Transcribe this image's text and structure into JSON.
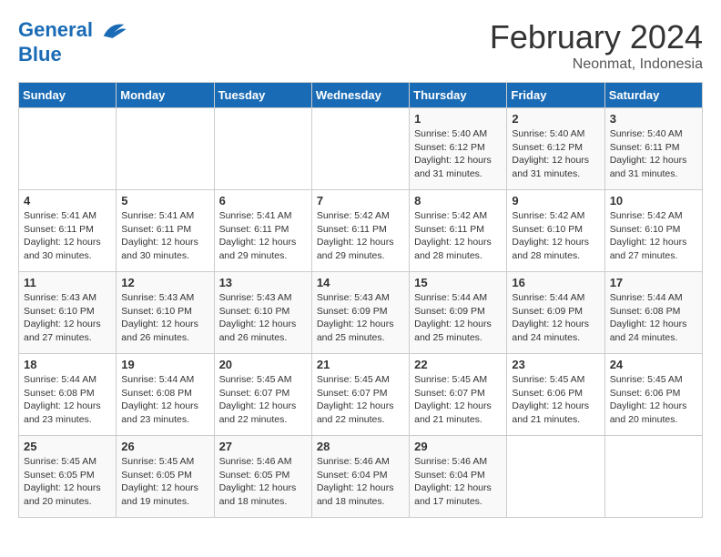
{
  "header": {
    "logo_line1": "General",
    "logo_line2": "Blue",
    "month_title": "February 2024",
    "subtitle": "Neonmat, Indonesia"
  },
  "days_of_week": [
    "Sunday",
    "Monday",
    "Tuesday",
    "Wednesday",
    "Thursday",
    "Friday",
    "Saturday"
  ],
  "weeks": [
    [
      {
        "day": "",
        "info": ""
      },
      {
        "day": "",
        "info": ""
      },
      {
        "day": "",
        "info": ""
      },
      {
        "day": "",
        "info": ""
      },
      {
        "day": "1",
        "info": "Sunrise: 5:40 AM\nSunset: 6:12 PM\nDaylight: 12 hours\nand 31 minutes."
      },
      {
        "day": "2",
        "info": "Sunrise: 5:40 AM\nSunset: 6:12 PM\nDaylight: 12 hours\nand 31 minutes."
      },
      {
        "day": "3",
        "info": "Sunrise: 5:40 AM\nSunset: 6:11 PM\nDaylight: 12 hours\nand 31 minutes."
      }
    ],
    [
      {
        "day": "4",
        "info": "Sunrise: 5:41 AM\nSunset: 6:11 PM\nDaylight: 12 hours\nand 30 minutes."
      },
      {
        "day": "5",
        "info": "Sunrise: 5:41 AM\nSunset: 6:11 PM\nDaylight: 12 hours\nand 30 minutes."
      },
      {
        "day": "6",
        "info": "Sunrise: 5:41 AM\nSunset: 6:11 PM\nDaylight: 12 hours\nand 29 minutes."
      },
      {
        "day": "7",
        "info": "Sunrise: 5:42 AM\nSunset: 6:11 PM\nDaylight: 12 hours\nand 29 minutes."
      },
      {
        "day": "8",
        "info": "Sunrise: 5:42 AM\nSunset: 6:11 PM\nDaylight: 12 hours\nand 28 minutes."
      },
      {
        "day": "9",
        "info": "Sunrise: 5:42 AM\nSunset: 6:10 PM\nDaylight: 12 hours\nand 28 minutes."
      },
      {
        "day": "10",
        "info": "Sunrise: 5:42 AM\nSunset: 6:10 PM\nDaylight: 12 hours\nand 27 minutes."
      }
    ],
    [
      {
        "day": "11",
        "info": "Sunrise: 5:43 AM\nSunset: 6:10 PM\nDaylight: 12 hours\nand 27 minutes."
      },
      {
        "day": "12",
        "info": "Sunrise: 5:43 AM\nSunset: 6:10 PM\nDaylight: 12 hours\nand 26 minutes."
      },
      {
        "day": "13",
        "info": "Sunrise: 5:43 AM\nSunset: 6:10 PM\nDaylight: 12 hours\nand 26 minutes."
      },
      {
        "day": "14",
        "info": "Sunrise: 5:43 AM\nSunset: 6:09 PM\nDaylight: 12 hours\nand 25 minutes."
      },
      {
        "day": "15",
        "info": "Sunrise: 5:44 AM\nSunset: 6:09 PM\nDaylight: 12 hours\nand 25 minutes."
      },
      {
        "day": "16",
        "info": "Sunrise: 5:44 AM\nSunset: 6:09 PM\nDaylight: 12 hours\nand 24 minutes."
      },
      {
        "day": "17",
        "info": "Sunrise: 5:44 AM\nSunset: 6:08 PM\nDaylight: 12 hours\nand 24 minutes."
      }
    ],
    [
      {
        "day": "18",
        "info": "Sunrise: 5:44 AM\nSunset: 6:08 PM\nDaylight: 12 hours\nand 23 minutes."
      },
      {
        "day": "19",
        "info": "Sunrise: 5:44 AM\nSunset: 6:08 PM\nDaylight: 12 hours\nand 23 minutes."
      },
      {
        "day": "20",
        "info": "Sunrise: 5:45 AM\nSunset: 6:07 PM\nDaylight: 12 hours\nand 22 minutes."
      },
      {
        "day": "21",
        "info": "Sunrise: 5:45 AM\nSunset: 6:07 PM\nDaylight: 12 hours\nand 22 minutes."
      },
      {
        "day": "22",
        "info": "Sunrise: 5:45 AM\nSunset: 6:07 PM\nDaylight: 12 hours\nand 21 minutes."
      },
      {
        "day": "23",
        "info": "Sunrise: 5:45 AM\nSunset: 6:06 PM\nDaylight: 12 hours\nand 21 minutes."
      },
      {
        "day": "24",
        "info": "Sunrise: 5:45 AM\nSunset: 6:06 PM\nDaylight: 12 hours\nand 20 minutes."
      }
    ],
    [
      {
        "day": "25",
        "info": "Sunrise: 5:45 AM\nSunset: 6:05 PM\nDaylight: 12 hours\nand 20 minutes."
      },
      {
        "day": "26",
        "info": "Sunrise: 5:45 AM\nSunset: 6:05 PM\nDaylight: 12 hours\nand 19 minutes."
      },
      {
        "day": "27",
        "info": "Sunrise: 5:46 AM\nSunset: 6:05 PM\nDaylight: 12 hours\nand 18 minutes."
      },
      {
        "day": "28",
        "info": "Sunrise: 5:46 AM\nSunset: 6:04 PM\nDaylight: 12 hours\nand 18 minutes."
      },
      {
        "day": "29",
        "info": "Sunrise: 5:46 AM\nSunset: 6:04 PM\nDaylight: 12 hours\nand 17 minutes."
      },
      {
        "day": "",
        "info": ""
      },
      {
        "day": "",
        "info": ""
      }
    ]
  ]
}
